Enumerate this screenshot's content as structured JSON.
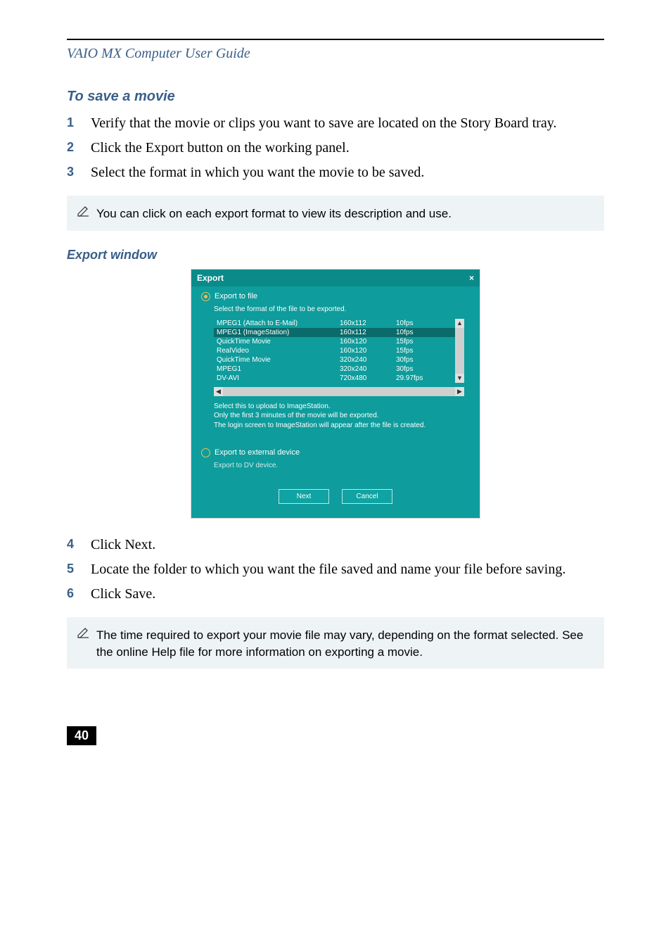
{
  "header": {
    "running_head": "VAIO MX Computer User Guide"
  },
  "sections": {
    "save_movie_title": "To save a movie",
    "export_window_caption": "Export window"
  },
  "steps_top": [
    {
      "n": "1",
      "t": "Verify that the movie or clips you want to save are located on the Story Board tray."
    },
    {
      "n": "2",
      "t": "Click the Export button on the working panel."
    },
    {
      "n": "3",
      "t": "Select the format in which you want the movie to be saved."
    }
  ],
  "note1": "You can click on each export format to view its description and use.",
  "dialog": {
    "title": "Export",
    "close": "×",
    "radio1": "Export to file",
    "sub_instr": "Select the format of the file to be exported.",
    "formats": [
      {
        "name": "MPEG1 (Attach to E-Mail)",
        "res": "160x112",
        "fps": "10fps",
        "selected": false
      },
      {
        "name": "MPEG1 (ImageStation)",
        "res": "160x112",
        "fps": "10fps",
        "selected": true
      },
      {
        "name": "QuickTime Movie",
        "res": "160x120",
        "fps": "15fps",
        "selected": false
      },
      {
        "name": "RealVideo",
        "res": "160x120",
        "fps": "15fps",
        "selected": false
      },
      {
        "name": "QuickTime Movie",
        "res": "320x240",
        "fps": "30fps",
        "selected": false
      },
      {
        "name": "MPEG1",
        "res": "320x240",
        "fps": "30fps",
        "selected": false
      },
      {
        "name": "DV-AVI",
        "res": "720x480",
        "fps": "29.97fps",
        "selected": false
      }
    ],
    "desc": [
      "Select this to upload to ImageStation.",
      "Only the first 3 minutes of the movie will be exported.",
      "The login screen to ImageStation will appear after the file is created."
    ],
    "radio2": "Export to external device",
    "ext_label": "Export to DV device.",
    "btn_next": "Next",
    "btn_cancel": "Cancel"
  },
  "steps_bottom": [
    {
      "n": "4",
      "t": "Click Next."
    },
    {
      "n": "5",
      "t": "Locate the folder to which you want the file saved and name your file before saving."
    },
    {
      "n": "6",
      "t": "Click Save."
    }
  ],
  "note2": "The time required to export your movie file may vary, depending on the format selected. See the online Help file for more information on exporting a movie.",
  "page_number": "40"
}
